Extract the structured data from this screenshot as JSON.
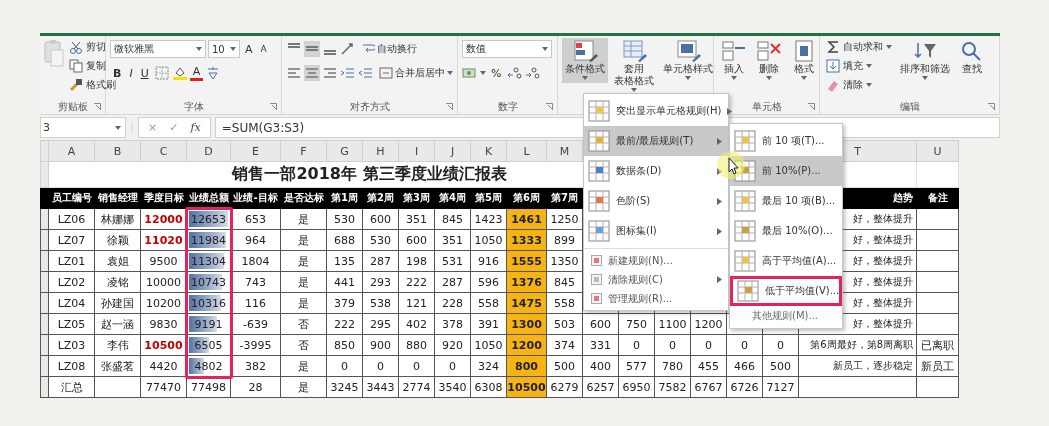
{
  "ribbon": {
    "groups": [
      {
        "kind": "clipboard",
        "label": "剪贴板",
        "items": [
          "剪切",
          "复制",
          "格式刷"
        ]
      },
      {
        "kind": "font",
        "label": "字体",
        "font_name": "微软雅黑",
        "font_size": "10",
        "grow": "A",
        "shrink": "A",
        "styles": [
          "B",
          "I",
          "U"
        ],
        "font_color": "A"
      },
      {
        "kind": "alignment",
        "label": "对齐方式",
        "wrap": "自动换行",
        "merge": "合并后居中"
      },
      {
        "kind": "number",
        "label": "数字",
        "format": "数值",
        "percent": "%"
      },
      {
        "kind": "styles",
        "items": [
          {
            "lines": [
              "条件格式"
            ],
            "selected": true
          },
          {
            "lines": [
              "套用",
              "表格格式"
            ],
            "selected": false
          },
          {
            "lines": [
              "单元格样式"
            ],
            "selected": false
          }
        ]
      },
      {
        "kind": "cells",
        "label": "单元格",
        "items": [
          "插入",
          "删除",
          "格式"
        ]
      },
      {
        "kind": "editing",
        "label": "编辑",
        "items": [
          "自动求和",
          "填充",
          "清除"
        ],
        "sort": "排序和筛选",
        "find": "查找"
      }
    ]
  },
  "formula_bar": {
    "name_box": "3",
    "cancel": "×",
    "enter": "✓",
    "function": "fx",
    "formula": "=SUM(G3:S3)"
  },
  "sheet": {
    "columns_left": [
      "A",
      "B",
      "C",
      "D",
      "E",
      "F",
      "G",
      "H",
      "I",
      "J",
      "K",
      "L",
      "M"
    ],
    "columns_right": [
      "T",
      "U"
    ],
    "title": "销售一部2018年 第三季度业绩汇报表",
    "framed": true,
    "header_left": [
      "员工编号",
      "销售经理",
      "季度目标",
      "业绩总额",
      "业绩-目标",
      "是否达标",
      "第1周",
      "第2周",
      "第3周",
      "第4周",
      "第5周",
      "第6周",
      "第7周"
    ],
    "header_right": [
      "趋势",
      "备注"
    ],
    "rows": [
      {
        "cells": [
          "LZ06",
          "林娜娜",
          {
            "text": "12000",
            "red": true
          },
          {
            "text": "12653",
            "level": 1.0
          },
          "653",
          "是",
          "530",
          "600",
          "351",
          "845",
          "1423",
          {
            "text": "1461",
            "color": "#f5b414"
          },
          "1250",
          null,
          null,
          null,
          null,
          null,
          null,
          "好，整体提升",
          null
        ]
      },
      {
        "cells": [
          "LZ07",
          "徐颖",
          {
            "text": "11020",
            "red": true
          },
          {
            "text": "11984",
            "level": 0.95
          },
          "964",
          "是",
          "688",
          "530",
          "600",
          "351",
          "1050",
          {
            "text": "1333",
            "color": "#f5b414"
          },
          "899",
          null,
          null,
          null,
          null,
          null,
          null,
          "好，整体提升",
          null
        ]
      },
      {
        "cells": [
          "LZ01",
          "袁姐",
          "9500",
          {
            "text": "11304",
            "level": 0.89
          },
          "1804",
          "是",
          "135",
          "287",
          "198",
          "531",
          "916",
          {
            "text": "1555",
            "color": "#f5b414"
          },
          "1350",
          null,
          null,
          null,
          null,
          null,
          null,
          "好，整体提升",
          null
        ]
      },
      {
        "cells": [
          "LZ02",
          "凌铭",
          "10000",
          {
            "text": "10743",
            "level": 0.85
          },
          "743",
          "是",
          "441",
          "293",
          "222",
          "287",
          "596",
          {
            "text": "1376",
            "color": "#f5b414"
          },
          "845",
          null,
          null,
          null,
          null,
          null,
          null,
          "好，整体提升",
          null
        ]
      },
      {
        "cells": [
          "LZ04",
          "孙建国",
          "10200",
          {
            "text": "10316",
            "level": 0.82
          },
          "116",
          "是",
          "379",
          "538",
          "121",
          "228",
          "558",
          {
            "text": "1475",
            "color": "#f5b414"
          },
          "558",
          null,
          null,
          null,
          null,
          null,
          null,
          "好，整体提升",
          null
        ]
      },
      {
        "cells": [
          "LZ05",
          "赵一涵",
          "9830",
          {
            "text": "9191",
            "level": 0.73
          },
          "-639",
          "否",
          "222",
          "295",
          "402",
          "378",
          "391",
          {
            "text": "1300",
            "color": "#f5b414"
          },
          "503",
          "600",
          "750",
          "1100",
          "1200",
          null,
          null,
          "好，整体提升",
          null
        ]
      },
      {
        "cells": [
          "LZ03",
          "李伟",
          {
            "text": "10500",
            "red": true
          },
          {
            "text": "6505",
            "level": 0.51
          },
          "-3995",
          "否",
          "850",
          "900",
          "880",
          "920",
          "1050",
          {
            "text": "1200",
            "color": "#f5b414"
          },
          "374",
          "331",
          "0",
          "0",
          "0",
          "0",
          "0",
          "第6周最好，第8周离职",
          "已离职"
        ]
      },
      {
        "cells": [
          "LZ08",
          "张盛茗",
          "4420",
          {
            "text": "4802",
            "level": 0.38
          },
          "382",
          "是",
          "0",
          "0",
          "0",
          "0",
          "324",
          {
            "text": "800",
            "color": "#f5b414"
          },
          "500",
          "400",
          "577",
          "780",
          "455",
          "466",
          "500",
          "新员工，逐步稳定",
          "新员工"
        ]
      },
      {
        "cells": [
          "汇总",
          null,
          "77470",
          "77498",
          "28",
          "是",
          "3245",
          "3443",
          "2774",
          "3540",
          "6308",
          {
            "text": "10500",
            "color": "#f5b414"
          },
          "6279",
          "6257",
          "6950",
          "7582",
          "6767",
          "6726",
          "7127",
          null,
          null
        ]
      }
    ]
  },
  "menu": {
    "items": [
      {
        "label": "突出显示单元格规则(H)",
        "kind": "large",
        "submenu": true,
        "selected": false
      },
      {
        "label": "最前/最后规则(T)",
        "kind": "large",
        "submenu": true,
        "selected": true
      },
      {
        "label": "数据条(D)",
        "kind": "large",
        "submenu": true,
        "selected": false
      },
      {
        "label": "色阶(S)",
        "kind": "large",
        "submenu": true,
        "selected": false
      },
      {
        "label": "图标集(I)",
        "kind": "large",
        "submenu": true,
        "selected": false
      },
      {
        "label": "新建规则(N)...",
        "kind": "small",
        "submenu": false,
        "selected": false
      },
      {
        "label": "清除规则(C)",
        "kind": "small",
        "submenu": true,
        "selected": false
      },
      {
        "label": "管理规则(R)...",
        "kind": "small",
        "submenu": false,
        "selected": false
      }
    ],
    "submenu": [
      {
        "label": "前 10 项(T)...",
        "kind": "large",
        "selected": false,
        "outlined": false
      },
      {
        "label": "前 10%(P)...",
        "kind": "large",
        "selected": true,
        "outlined": false
      },
      {
        "label": "最后 10 项(B)...",
        "kind": "large",
        "selected": false,
        "outlined": false
      },
      {
        "label": "最后 10%(O)...",
        "kind": "large",
        "selected": false,
        "outlined": false
      },
      {
        "label": "高于平均值(A)...",
        "kind": "large",
        "selected": false,
        "outlined": false
      },
      {
        "label": "低于平均值(V)...",
        "kind": "large",
        "selected": false,
        "outlined": true
      },
      {
        "label": "其他规则(M)...",
        "kind": "plain",
        "selected": false,
        "outlined": false
      }
    ]
  }
}
